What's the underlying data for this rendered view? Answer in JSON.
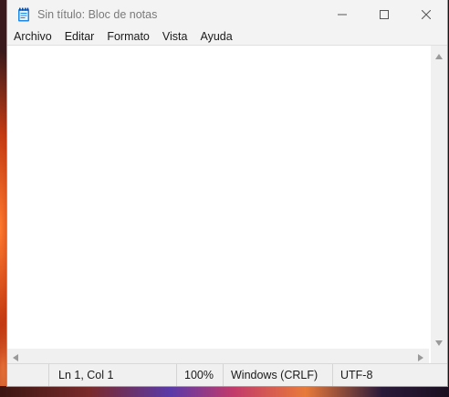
{
  "window": {
    "title": "Sin título: Bloc de notas",
    "app_icon": "notepad-icon"
  },
  "controls": {
    "minimize_icon": "minimize-icon",
    "maximize_icon": "maximize-icon",
    "close_icon": "close-icon"
  },
  "menu": {
    "items": [
      {
        "label": "Archivo"
      },
      {
        "label": "Editar"
      },
      {
        "label": "Formato"
      },
      {
        "label": "Vista"
      },
      {
        "label": "Ayuda"
      }
    ]
  },
  "editor": {
    "content": ""
  },
  "status": {
    "position": "Ln 1, Col 1",
    "zoom": "100%",
    "line_endings": "Windows (CRLF)",
    "encoding": "UTF-8"
  },
  "colors": {
    "title_text": "#7a7a7a",
    "accent_icon": "#1e88e5"
  }
}
